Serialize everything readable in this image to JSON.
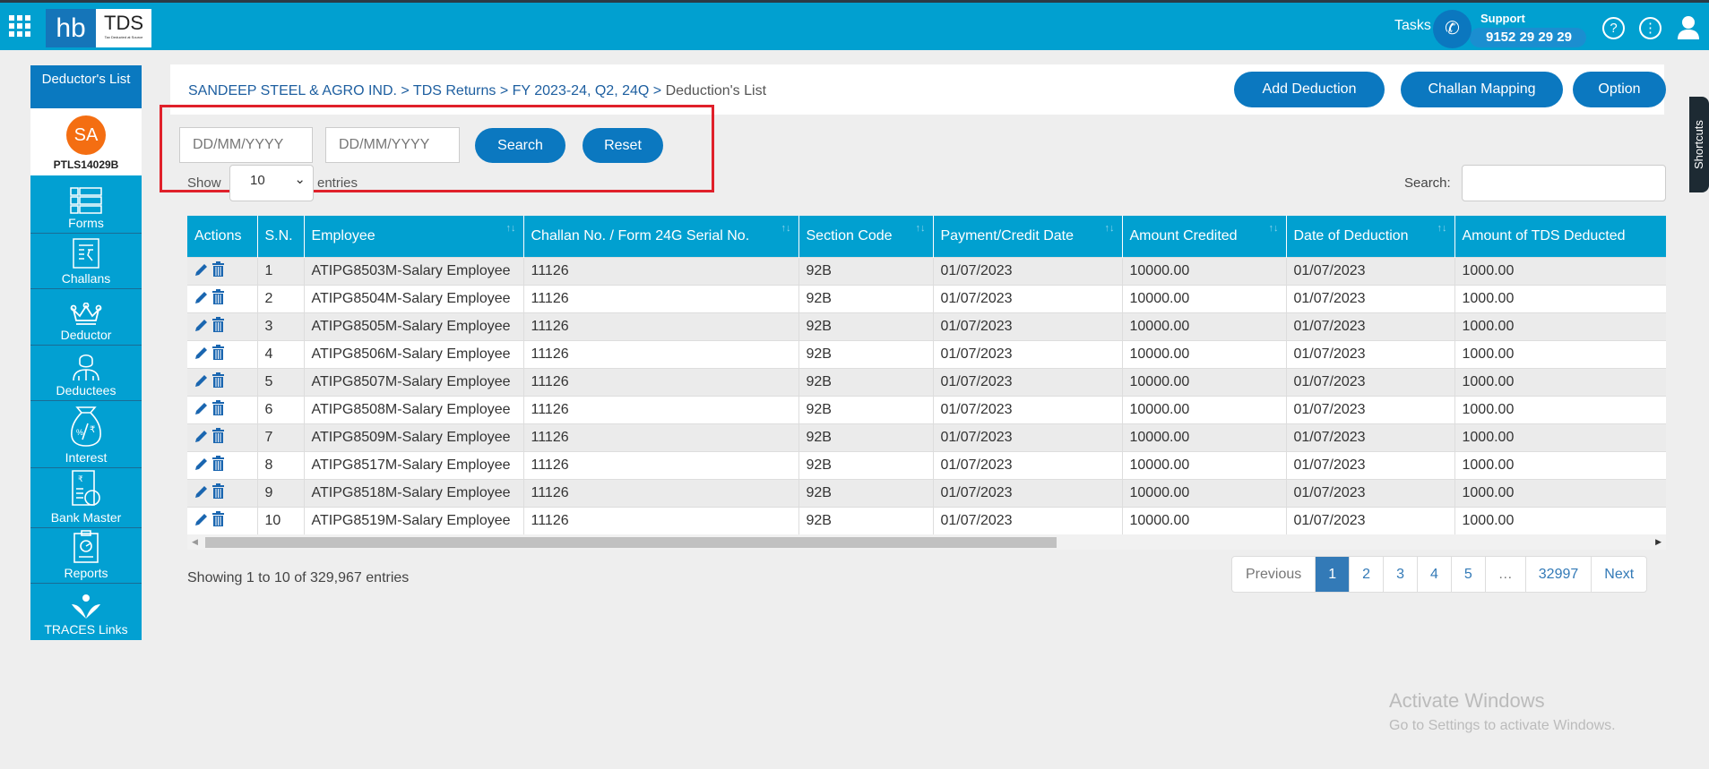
{
  "header": {
    "logo_left": "hb",
    "logo_right": "TDS",
    "logo_tagline": "Tax Deducted at Source",
    "tasks": "Tasks",
    "support_label": "Support",
    "support_number": "9152 29 29 29",
    "help_icon": "?",
    "more_icon": "⋮"
  },
  "sidebar": {
    "title": "Deductor's List",
    "avatar": "SA",
    "code": "PTLS14029B",
    "items": [
      {
        "label": "Forms",
        "icon": "forms-icon"
      },
      {
        "label": "Challans",
        "icon": "challan-receipt-icon"
      },
      {
        "label": "Deductor",
        "icon": "crown-icon"
      },
      {
        "label": "Deductees",
        "icon": "person-icon"
      },
      {
        "label": "Interest",
        "icon": "money-bag-icon"
      },
      {
        "label": "Bank Master",
        "icon": "bank-document-icon"
      },
      {
        "label": "Reports",
        "icon": "clipboard-chart-icon"
      },
      {
        "label": "TRACES Links",
        "icon": "traces-logo-icon"
      }
    ]
  },
  "breadcrumb": {
    "items": [
      "SANDEEP STEEL & AGRO IND.",
      "TDS Returns",
      "FY 2023-24, Q2, 24Q"
    ],
    "separator": ">",
    "current": "Deduction's List"
  },
  "actions": {
    "add_deduction": "Add Deduction",
    "challan_mapping": "Challan Mapping",
    "option": "Option"
  },
  "filter": {
    "from_placeholder": "DD/MM/YYYY",
    "to_placeholder": "DD/MM/YYYY",
    "search": "Search",
    "reset": "Reset"
  },
  "length": {
    "show": "Show",
    "value": "10",
    "entries": "entries"
  },
  "search": {
    "label": "Search:",
    "value": ""
  },
  "table": {
    "columns": [
      "Actions",
      "S.N.",
      "Employee",
      "Challan No. / Form 24G Serial No.",
      "Section Code",
      "Payment/Credit Date",
      "Amount Credited",
      "Date of Deduction",
      "Amount of TDS Deducted"
    ],
    "rows": [
      [
        "1",
        "ATIPG8503M-Salary Employee",
        "11126",
        "92B",
        "01/07/2023",
        "10000.00",
        "01/07/2023",
        "1000.00"
      ],
      [
        "2",
        "ATIPG8504M-Salary Employee",
        "11126",
        "92B",
        "01/07/2023",
        "10000.00",
        "01/07/2023",
        "1000.00"
      ],
      [
        "3",
        "ATIPG8505M-Salary Employee",
        "11126",
        "92B",
        "01/07/2023",
        "10000.00",
        "01/07/2023",
        "1000.00"
      ],
      [
        "4",
        "ATIPG8506M-Salary Employee",
        "11126",
        "92B",
        "01/07/2023",
        "10000.00",
        "01/07/2023",
        "1000.00"
      ],
      [
        "5",
        "ATIPG8507M-Salary Employee",
        "11126",
        "92B",
        "01/07/2023",
        "10000.00",
        "01/07/2023",
        "1000.00"
      ],
      [
        "6",
        "ATIPG8508M-Salary Employee",
        "11126",
        "92B",
        "01/07/2023",
        "10000.00",
        "01/07/2023",
        "1000.00"
      ],
      [
        "7",
        "ATIPG8509M-Salary Employee",
        "11126",
        "92B",
        "01/07/2023",
        "10000.00",
        "01/07/2023",
        "1000.00"
      ],
      [
        "8",
        "ATIPG8517M-Salary Employee",
        "11126",
        "92B",
        "01/07/2023",
        "10000.00",
        "01/07/2023",
        "1000.00"
      ],
      [
        "9",
        "ATIPG8518M-Salary Employee",
        "11126",
        "92B",
        "01/07/2023",
        "10000.00",
        "01/07/2023",
        "1000.00"
      ],
      [
        "10",
        "ATIPG8519M-Salary Employee",
        "11126",
        "92B",
        "01/07/2023",
        "10000.00",
        "01/07/2023",
        "1000.00"
      ]
    ]
  },
  "info": "Showing 1 to 10 of 329,967 entries",
  "pagination": {
    "previous": "Previous",
    "pages": [
      "1",
      "2",
      "3",
      "4",
      "5",
      "…",
      "32997"
    ],
    "active": "1",
    "next": "Next"
  },
  "watermark": {
    "title": "Activate Windows",
    "subtitle": "Go to Settings to activate Windows."
  },
  "shortcuts": "Shortcuts",
  "colors": {
    "topbar": "#01a0d0",
    "primary_button": "#0b78c0",
    "highlight_box": "#e0202a",
    "avatar": "#f46e12"
  }
}
